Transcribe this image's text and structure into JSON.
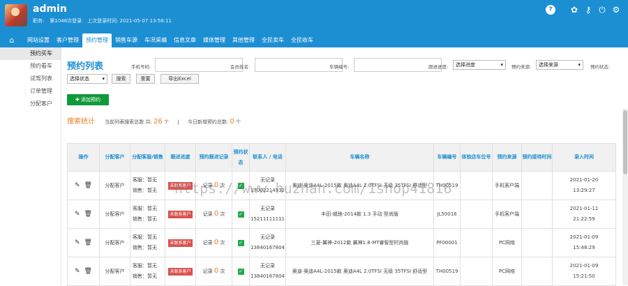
{
  "user": {
    "name": "admin",
    "role_label": "职务:",
    "login_count": "第1048次登录",
    "last_login_label": "上次登录时间:",
    "last_login": "2021-05-07 13:58:11"
  },
  "header_icons": [
    "help-icon",
    "skin-icon",
    "key-icon",
    "power-icon",
    "gear-icon"
  ],
  "nav": [
    {
      "label": "网站设置"
    },
    {
      "label": "客户管理"
    },
    {
      "label": "预约管理",
      "active": true
    },
    {
      "label": "销售车源"
    },
    {
      "label": "车况采编"
    },
    {
      "label": "信息文章"
    },
    {
      "label": "媒体管理"
    },
    {
      "label": "其他管理"
    },
    {
      "label": "全民卖车"
    },
    {
      "label": "全民收车"
    }
  ],
  "sidebar": [
    {
      "label": "预约买车",
      "active": true
    },
    {
      "label": "预约看车"
    },
    {
      "label": "试驾列表"
    },
    {
      "label": "订单管理"
    },
    {
      "label": "分配客户"
    }
  ],
  "page": {
    "title": "预约列表",
    "filters": {
      "phone_label": "手机号码:",
      "member_label": "会员姓名:",
      "car_no_label": "车辆编号:",
      "progress_label": "跟进进度:",
      "progress_value": "选择进度",
      "source_label": "预约来源:",
      "source_value": "选择来源",
      "status_label": "预约状态:",
      "status_value": "选择状态"
    },
    "buttons": {
      "search": "搜索",
      "reset": "重置",
      "export": "导出Excel",
      "add": "添加预约"
    },
    "stats": {
      "title": "搜索统计",
      "total_label": "当前列表搜索总数 共:",
      "total": "26",
      "unit": "个",
      "today_label": "今日新增预约总数:",
      "today": "0",
      "today_unit": "个"
    }
  },
  "table": {
    "headers": [
      "操作",
      "分配客户",
      "分配客服/销售",
      "跟进进度",
      "预约跟进记录",
      "预约状态",
      "联系人 / 电话",
      "车辆名称",
      "车辆编号",
      "体验店车位号",
      "预约来源",
      "预约接待时间",
      "录入时间"
    ],
    "rows": [
      {
        "assign": "分配客户",
        "service": "客服：暂无",
        "sales": "销售：暂无",
        "progress": "未联系客户",
        "rec_prefix": "记录",
        "rec_count": "0",
        "rec_suffix": "次",
        "contact": "无记录",
        "phone": "17002214932",
        "car": "奥迪-奥迪A4L-2015款 奥迪A4L 2.0TFSI 无级 35TFSI 舒适型",
        "car_no": "TH00519",
        "slot": "",
        "source": "手机客户端",
        "reception": "",
        "date": "2021-01-20",
        "time": "13:29:27"
      },
      {
        "assign": "分配客户",
        "service": "客服：暂无",
        "sales": "销售：暂无",
        "progress": "未联系客户",
        "rec_prefix": "记录",
        "rec_count": "0",
        "rec_suffix": "次",
        "contact": "无记录",
        "phone": "15211111111",
        "car": "丰田-威驰-2014款 1.3 手动 型尚版",
        "car_no": "JL50016",
        "slot": "",
        "source": "手机客户端",
        "reception": "",
        "date": "2021-01-11",
        "time": "21:22:59"
      },
      {
        "assign": "分配客户",
        "service": "客服：暂无",
        "sales": "销售：暂无",
        "progress": "未联系客户",
        "rec_prefix": "记录",
        "rec_count": "0",
        "rec_suffix": "次",
        "contact": "无记录",
        "phone": "13840167804",
        "car": "三菱-翼神-2012款 翼神1.8-MT睿智型时尚版",
        "car_no": "PF00001",
        "slot": "",
        "source": "PC网络",
        "reception": "",
        "date": "2021-01-09",
        "time": "15:48:29"
      },
      {
        "assign": "分配客户",
        "service": "客服：暂无",
        "sales": "销售：暂无",
        "progress": "未联系客户",
        "rec_prefix": "记录",
        "rec_count": "0",
        "rec_suffix": "次",
        "contact": "无记录",
        "phone": "13840167804",
        "car": "奥迪-奥迪A4L-2015款 奥迪A4L 2.0TFSI 无级 35TFSI 舒适型",
        "car_no": "TH00519",
        "slot": "",
        "source": "PC网络",
        "reception": "",
        "date": "2021-01-09",
        "time": "15:21:50"
      }
    ]
  },
  "watermark": "https://www.huzhan.com/1shop41816"
}
